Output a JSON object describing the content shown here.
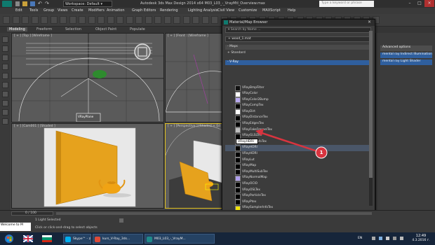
{
  "title_bar": {
    "workspace": "Workspace: Default",
    "title": "Autodesk 3ds Max Design 2014 x64     M03_L03_-_VrayMtl_Overview.max",
    "search_placeholder": "Type a keyword or phrase"
  },
  "menus": [
    "Edit",
    "Tools",
    "Group",
    "Views",
    "Create",
    "Modifiers",
    "Animation",
    "Graph Editors",
    "Rendering",
    "Lighting Analysis",
    "Civil View",
    "Customize",
    "MAXScript",
    "Help"
  ],
  "ribbon_tabs": [
    "Modeling",
    "Freeform",
    "Selection",
    "Object Paint",
    "Populate"
  ],
  "viewports": {
    "top": "[ + ] [Top ] [Wireframe ]",
    "front": "[ + ] [Front ] [Wireframe ]",
    "camera": "[ + ] [Cam001 ] [Shaded ]",
    "perspective": "[ + ] [Perspective ] [Shaded + Ed",
    "top_object_label": "VRayPlane"
  },
  "dialog": {
    "title": "Material/Map Browser",
    "search_placeholder": "Search by Name ...",
    "field_value": "+ wood_1.mat",
    "section_maps": "- Maps",
    "section_standard": "+ Standard",
    "section_vray": "- V-Ray",
    "ok": "OK",
    "cancel": "Cancel",
    "items": [
      {
        "label": "VRayBmpFilter",
        "swatch": "#111111"
      },
      {
        "label": "VRayColor",
        "swatch": "#ffffff"
      },
      {
        "label": "VRayColor2Bump",
        "swatch": "#b8a8f0"
      },
      {
        "label": "VRayCompTex",
        "swatch": "#000000"
      },
      {
        "label": "VRayDirt",
        "swatch": "#ffffff"
      },
      {
        "label": "VRayDistanceTex",
        "swatch": "#000000"
      },
      {
        "label": "VRayEdgesTex",
        "swatch": "#000000"
      },
      {
        "label": "VRayFakeFresnelTex",
        "swatch": "#bfbfbf"
      },
      {
        "label": "VRayGLSLTex",
        "swatch": "#000000"
      },
      {
        "label": "VRayHairInfoTex",
        "swatch": "#000000"
      },
      {
        "label": "VRayHDRI",
        "swatch": "#000000"
      },
      {
        "label": "VRayHDRI",
        "swatch": "#000000"
      },
      {
        "label": "VRayLut",
        "swatch": "#000000"
      },
      {
        "label": "VRayMap",
        "swatch": "#000000"
      },
      {
        "label": "VRayMultiSubTex",
        "swatch": "#000000"
      },
      {
        "label": "VRayNormalMap",
        "swatch": "#b0a0ef"
      },
      {
        "label": "VRayOCIO",
        "swatch": "#000000"
      },
      {
        "label": "VRayOSLTex",
        "swatch": "#000000"
      },
      {
        "label": "VRayParticleTex",
        "swatch": "#000000"
      },
      {
        "label": "VRayPtex",
        "swatch": "#000000"
      },
      {
        "label": "VRaySamplerInfoTex",
        "swatch": "#f2e40a"
      },
      {
        "label": "VRaySky",
        "swatch": "#ffffff"
      },
      {
        "label": "VRaySoftbox",
        "swatch": "#000000"
      }
    ]
  },
  "tooltip": "VRayHDRI",
  "callout_number": "1",
  "command_panel": {
    "items": [
      "Advanced options",
      "mental ray Indirect Illumination",
      "mental ray Light Shader"
    ]
  },
  "status": {
    "frames": "0 / 100",
    "selected": "1 Light Selected",
    "hint": "Click or click-and-drag to select objects",
    "maxscript": "Welcome to M"
  },
  "taskbar": {
    "tasks": [
      {
        "label": "Skype™ - zlatkov...",
        "color": "#00aff0"
      },
      {
        "label": "kurs_V-Ray_3ds...",
        "color": "#dd4b39"
      },
      {
        "label": "M03_L03_-_VrayM...",
        "color": "#1f8a8a"
      }
    ],
    "language": "EN",
    "time": "12:49",
    "date": "4.3.2016 г."
  }
}
